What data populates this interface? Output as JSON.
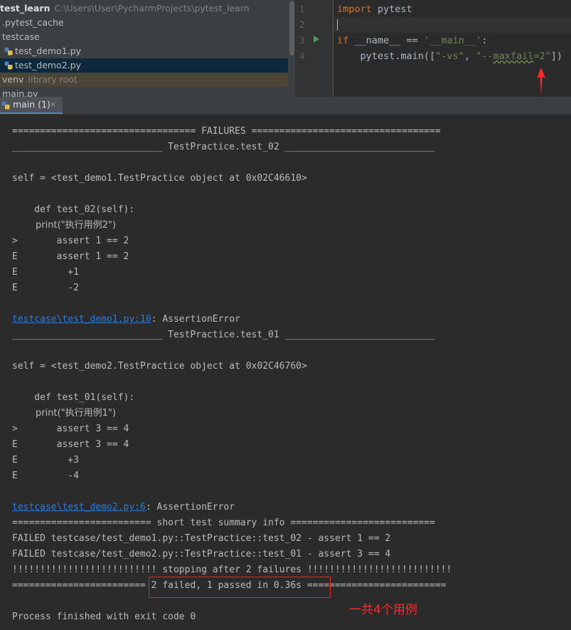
{
  "project_tree": {
    "root": {
      "name": "test_learn",
      "path": "C:\\Users\\User\\PycharmProjects\\pytest_learn"
    },
    "items": [
      {
        "label": ".pytest_cache"
      },
      {
        "label": "testcase"
      },
      {
        "label": "test_demo1.py"
      },
      {
        "label": "test_demo2.py"
      },
      {
        "label": "venv",
        "note": "library root"
      },
      {
        "label": "main.py"
      }
    ]
  },
  "editor": {
    "line_numbers": [
      "1",
      "2",
      "3",
      "4"
    ],
    "line1": {
      "kw": "import",
      "rest": " pytest"
    },
    "line3": {
      "kw": "if",
      "mid": " __name__ == ",
      "str": "'__main__'",
      "end": ":"
    },
    "line4": {
      "pre": "    pytest.main([",
      "s1": "\"-vs\"",
      "sep": ", ",
      "s2a": "\"--",
      "s2b": "maxfail",
      "s2c": "=2\"",
      "end": "])"
    }
  },
  "run_tab": {
    "label": "main (1)",
    "close": "×"
  },
  "console": {
    "lines": [
      "================================= FAILURES ==================================",
      "___________________________ TestPractice.test_02 ___________________________",
      "",
      "self = <test_demo1.TestPractice object at 0x02C46610>",
      "",
      "    def test_02(self):",
      "        print(\"执行用例2\")",
      ">       assert 1 == 2",
      "E       assert 1 == 2",
      "E         +1",
      "E         -2",
      "",
      "",
      "___________________________ TestPractice.test_01 ___________________________",
      "",
      "self = <test_demo2.TestPractice object at 0x02C46760>",
      "",
      "    def test_01(self):",
      "        print(\"执行用例1\")",
      ">       assert 3 == 4",
      "E       assert 3 == 4",
      "E         +3",
      "E         -4",
      "",
      "",
      "========================= short test summary info ==========================",
      "FAILED testcase/test_demo1.py::TestPractice::test_02 - assert 1 == 2",
      "FAILED testcase/test_demo2.py::TestPractice::test_01 - assert 3 == 4",
      "!!!!!!!!!!!!!!!!!!!!!!!!!! stopping after 2 failures !!!!!!!!!!!!!!!!!!!!!!!!!!",
      "======================== 2 failed, 1 passed in 0.36s =========================",
      "",
      "Process finished with exit code 0"
    ],
    "error1": {
      "link": "testcase\\test_demo1.py:10",
      "rest": ": AssertionError"
    },
    "error2": {
      "link": "testcase\\test_demo2.py:6",
      "rest": ": AssertionError"
    }
  },
  "annotation": {
    "note": "一共4个用例",
    "color": "#ff2a2a"
  }
}
